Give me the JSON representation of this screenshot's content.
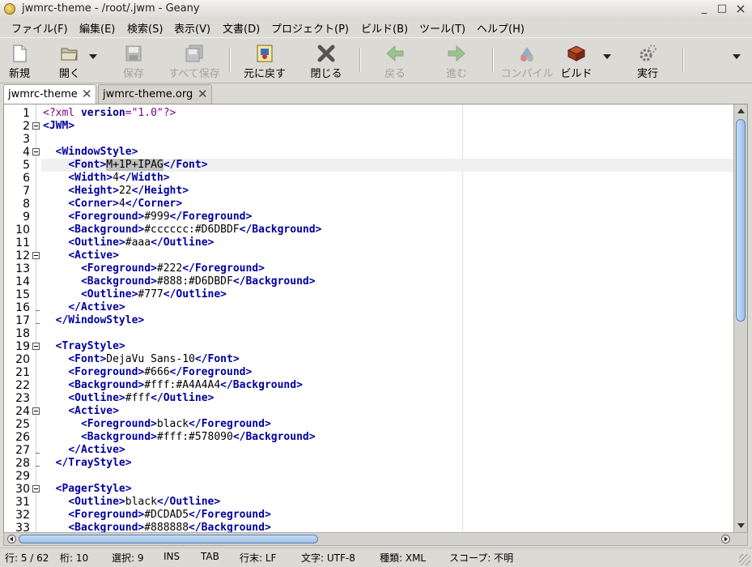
{
  "window": {
    "title": "jwmrc-theme - /root/.jwm - Geany",
    "minimize": "_",
    "maximize": "□",
    "close": "×"
  },
  "menu": [
    {
      "label": "ファイル(F)"
    },
    {
      "label": "編集(E)"
    },
    {
      "label": "検索(S)"
    },
    {
      "label": "表示(V)"
    },
    {
      "label": "文書(D)"
    },
    {
      "label": "プロジェクト(P)"
    },
    {
      "label": "ビルド(B)"
    },
    {
      "label": "ツール(T)"
    },
    {
      "label": "ヘルプ(H)"
    }
  ],
  "toolbar": {
    "new": "新規",
    "open": "開く",
    "save": "保存",
    "save_all": "すべて保存",
    "revert": "元に戻す",
    "close": "閉じる",
    "back": "戻る",
    "forward": "進む",
    "compile": "コンパイル",
    "build": "ビルド",
    "run": "実行"
  },
  "tabs": [
    {
      "label": "jwmrc-theme",
      "active": true
    },
    {
      "label": "jwmrc-theme.org",
      "active": false
    }
  ],
  "editor": {
    "line_numbers": [
      "1",
      "2",
      "3",
      "4",
      "5",
      "6",
      "7",
      "8",
      "9",
      "10",
      "11",
      "12",
      "13",
      "14",
      "15",
      "16",
      "17",
      "18",
      "19",
      "20",
      "21",
      "22",
      "23",
      "24",
      "25",
      "26",
      "27",
      "28",
      "29",
      "30",
      "31",
      "32",
      "33"
    ],
    "current_line": 5,
    "selected_text": "M+1P+IPAG"
  },
  "status": {
    "line": "行: 5 / 62",
    "col": "桁: 10",
    "sel": "選択: 9",
    "ins": "INS",
    "tab": "TAB",
    "eol": "行末: LF",
    "encoding": "文字: UTF-8",
    "filetype": "種類: XML",
    "scope": "スコープ: 不明"
  }
}
